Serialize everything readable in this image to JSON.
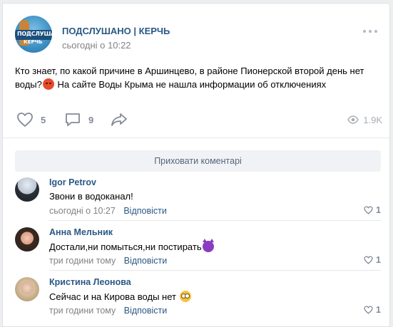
{
  "post": {
    "group_name": "ПОДСЛУШАНО | КЕРЧЬ",
    "avatar_text_line1": "ПОДСЛУШАНО",
    "avatar_text_line2": "КЕРЧЬ",
    "time": "сьогодні о 10:22",
    "text_part1": "Кто знает, по какой причине в Аршинцево, в районе Пионерской второй день нет воды?",
    "text_part2": " На сайте Воды Крыма не нашла информации об отключениях",
    "emoji": "angry-face",
    "likes": "5",
    "comments": "9",
    "views": "1.9K"
  },
  "hide_comments_label": "Приховати коментарі",
  "comments": [
    {
      "author": "Igor Petrov",
      "text": "Звони в водоканал!",
      "time": "сьогодні о 10:27",
      "reply_label": "Відповісти",
      "likes": "1"
    },
    {
      "author": "Анна Мельник",
      "text": "Достали,ни помыться,ни постирать",
      "emoji": "smiling-devil",
      "time": "три години тому",
      "reply_label": "Відповісти",
      "likes": "1"
    },
    {
      "author": "Кристина Леонова",
      "text": "Сейчас и на Кирова воды нет",
      "emoji": "flushed-face",
      "time": "три години тому",
      "reply_label": "Відповісти",
      "likes": "1"
    }
  ],
  "colors": {
    "link": "#2a5885",
    "meta": "#828282",
    "icon": "#828a99",
    "background": "#edeef0"
  }
}
